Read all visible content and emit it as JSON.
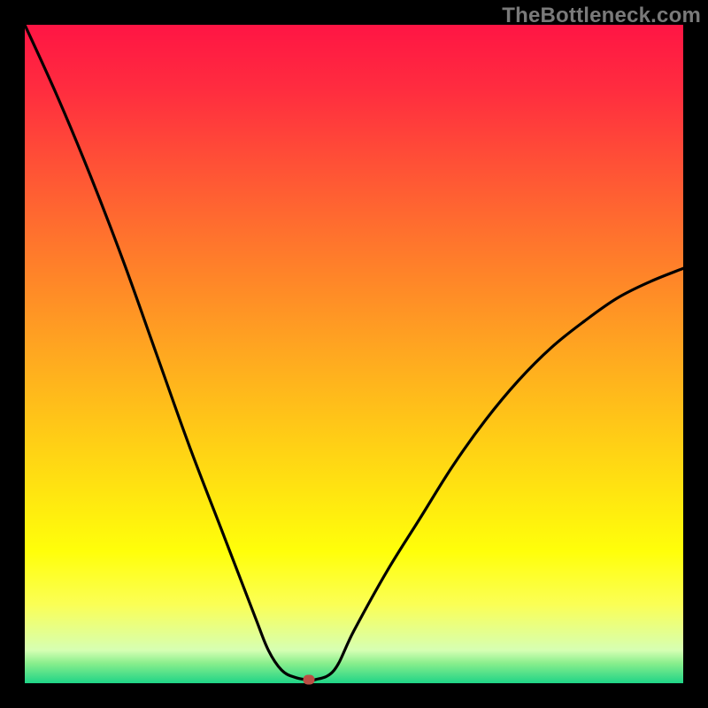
{
  "watermark": "TheBottleneck.com",
  "chart_data": {
    "type": "line",
    "title": "",
    "xlabel": "",
    "ylabel": "",
    "xlim": [
      0,
      100
    ],
    "ylim": [
      0,
      100
    ],
    "grid": false,
    "legend": false,
    "series": [
      {
        "name": "bottleneck-curve",
        "x": [
          0,
          5,
          10,
          15,
          20,
          25,
          30,
          35,
          37,
          39,
          41,
          43,
          44,
          47,
          50,
          55,
          60,
          65,
          70,
          75,
          80,
          85,
          90,
          95,
          100
        ],
        "values": [
          100,
          89,
          77,
          64,
          50,
          36,
          23,
          10,
          5,
          2,
          0.9,
          0.5,
          0.5,
          2,
          8,
          17,
          25,
          33,
          40,
          46,
          51,
          55,
          58.5,
          61,
          63
        ]
      }
    ],
    "marker": {
      "x": 43.2,
      "y": 0.5,
      "color": "#bb4e44"
    },
    "colors": {
      "frame": "#000000",
      "curve": "#000000",
      "gradient_top": "#ff1544",
      "gradient_bottom": "#1fd487"
    }
  }
}
